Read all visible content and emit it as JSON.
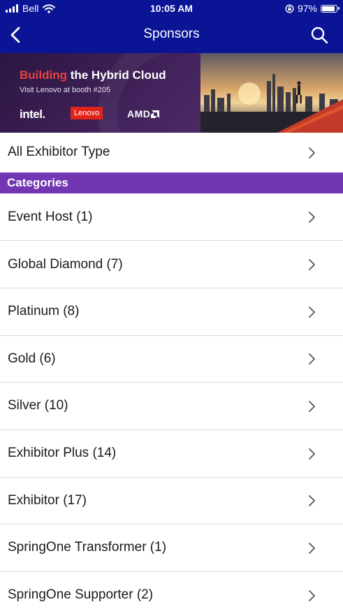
{
  "status_bar": {
    "carrier": "Bell",
    "time": "10:05 AM",
    "battery": "97%",
    "battery_level": 0.97
  },
  "nav": {
    "title": "Sponsors",
    "back_icon": "chevron-left-icon",
    "search_icon": "search-icon"
  },
  "banner": {
    "headline_accent": "Building",
    "headline_rest": " the Hybrid Cloud",
    "subline": "Visit Lenovo at booth #205",
    "brands": [
      "intel.",
      "Lenovo",
      "AMD"
    ]
  },
  "filter": {
    "label": "All Exhibitor Type"
  },
  "section": {
    "title": "Categories"
  },
  "categories": [
    "Event Host (1)",
    "Global Diamond (7)",
    "Platinum (8)",
    "Gold (6)",
    "Silver (10)",
    "Exhibitor Plus (14)",
    "Exhibitor (17)",
    "SpringOne Transformer (1)",
    "SpringOne Supporter (2)"
  ],
  "colors": {
    "header_bg": "#0a1495",
    "section_bg": "#7236b3",
    "accent_red": "#e8423d"
  }
}
